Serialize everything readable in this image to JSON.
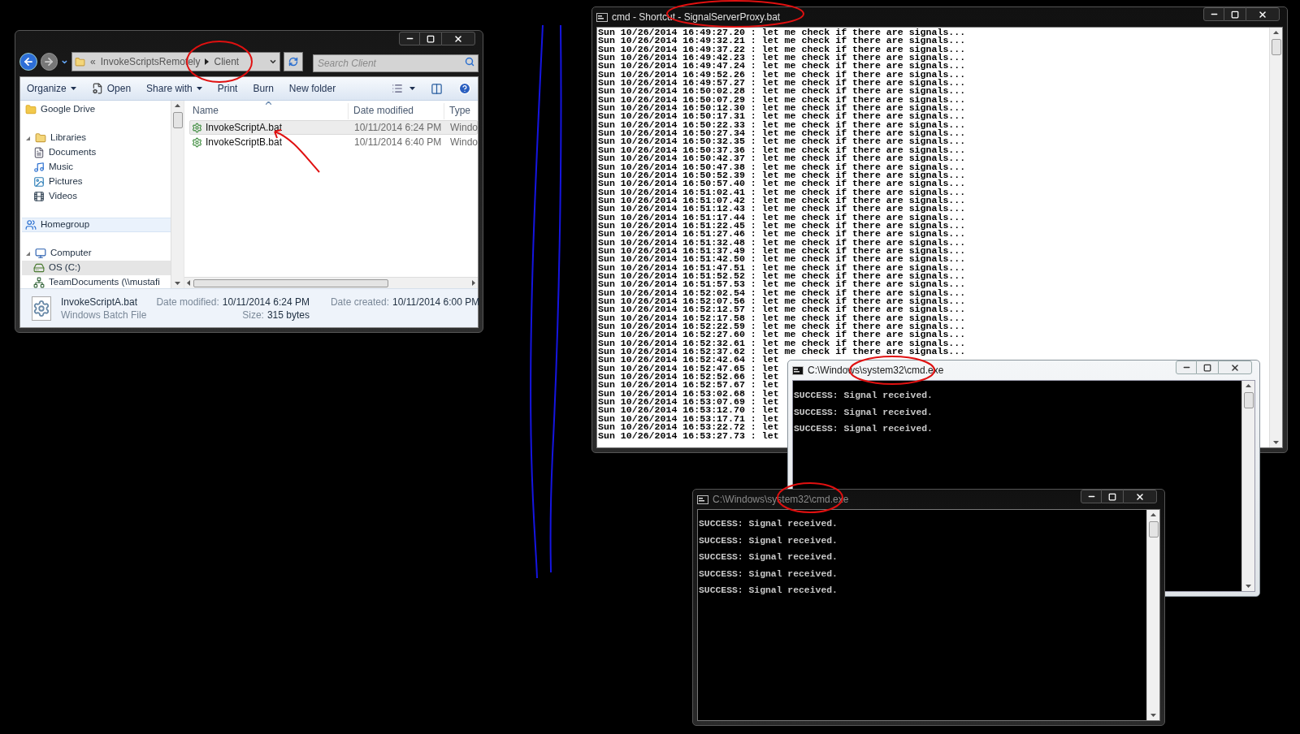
{
  "explorer": {
    "address": {
      "overflow": "«",
      "path": [
        "InvokeScriptsRemotely",
        "Client"
      ]
    },
    "search": {
      "placeholder": "Search Client"
    },
    "toolbar": [
      {
        "label": "Organize",
        "dropdown": true,
        "has_icon": false
      },
      {
        "label": "Open",
        "dropdown": false,
        "has_icon": true
      },
      {
        "label": "Share with",
        "dropdown": true,
        "has_icon": false
      },
      {
        "label": "Print",
        "dropdown": false,
        "has_icon": false
      },
      {
        "label": "Burn",
        "dropdown": false,
        "has_icon": false
      },
      {
        "label": "New folder",
        "dropdown": false,
        "has_icon": false
      }
    ],
    "nav": [
      {
        "label": "Google Drive",
        "kind": "drive",
        "selected": false,
        "hovered": false
      },
      {
        "label": "Libraries",
        "kind": "library",
        "selected": false,
        "hovered": false,
        "expanded": true,
        "children": [
          {
            "label": "Documents",
            "kind": "documents",
            "selected": false,
            "hovered": false
          },
          {
            "label": "Music",
            "kind": "music",
            "selected": false,
            "hovered": false
          },
          {
            "label": "Pictures",
            "kind": "pictures",
            "selected": false,
            "hovered": false
          },
          {
            "label": "Videos",
            "kind": "videos",
            "selected": false,
            "hovered": false
          }
        ]
      },
      {
        "label": "Homegroup",
        "kind": "homegroup",
        "selected": false,
        "hovered": true
      },
      {
        "label": "Computer",
        "kind": "computer",
        "selected": false,
        "hovered": false,
        "expanded": true,
        "children": [
          {
            "label": "OS (C:)",
            "kind": "disk",
            "selected": true,
            "hovered": false
          },
          {
            "label": "TeamDocuments (\\\\mustafi",
            "kind": "network",
            "selected": false,
            "hovered": false
          }
        ]
      }
    ],
    "columns": [
      "Name",
      "Date modified",
      "Type"
    ],
    "files": [
      {
        "name": "InvokeScriptA.bat",
        "modified": "10/11/2014 6:24 PM",
        "type": "Windo",
        "selected": true
      },
      {
        "name": "InvokeScriptB.bat",
        "modified": "10/11/2014 6:40 PM",
        "type": "Windo",
        "selected": false
      }
    ],
    "details": {
      "name": "InvokeScriptA.bat",
      "type": "Windows Batch File",
      "fields": [
        {
          "label": "Date modified:",
          "value": "10/11/2014 6:24 PM"
        },
        {
          "label": "Size:",
          "value": "315 bytes"
        },
        {
          "label": "Date created:",
          "value": "10/11/2014 6:00 PM"
        }
      ]
    }
  },
  "consoles": [
    {
      "title": "cmd - Shortcut - SignalServerProxy.bat",
      "active": false,
      "inverted": true,
      "lines": [
        "Sun 10/26/2014 16:49:27.20 : let me check if there are signals...",
        "Sun 10/26/2014 16:49:32.21 : let me check if there are signals...",
        "Sun 10/26/2014 16:49:37.22 : let me check if there are signals...",
        "Sun 10/26/2014 16:49:42.23 : let me check if there are signals...",
        "Sun 10/26/2014 16:49:47.24 : let me check if there are signals...",
        "Sun 10/26/2014 16:49:52.26 : let me check if there are signals...",
        "Sun 10/26/2014 16:49:57.27 : let me check if there are signals...",
        "Sun 10/26/2014 16:50:02.28 : let me check if there are signals...",
        "Sun 10/26/2014 16:50:07.29 : let me check if there are signals...",
        "Sun 10/26/2014 16:50:12.30 : let me check if there are signals...",
        "Sun 10/26/2014 16:50:17.31 : let me check if there are signals...",
        "Sun 10/26/2014 16:50:22.33 : let me check if there are signals...",
        "Sun 10/26/2014 16:50:27.34 : let me check if there are signals...",
        "Sun 10/26/2014 16:50:32.35 : let me check if there are signals...",
        "Sun 10/26/2014 16:50:37.36 : let me check if there are signals...",
        "Sun 10/26/2014 16:50:42.37 : let me check if there are signals...",
        "Sun 10/26/2014 16:50:47.38 : let me check if there are signals...",
        "Sun 10/26/2014 16:50:52.39 : let me check if there are signals...",
        "Sun 10/26/2014 16:50:57.40 : let me check if there are signals...",
        "Sun 10/26/2014 16:51:02.41 : let me check if there are signals...",
        "Sun 10/26/2014 16:51:07.42 : let me check if there are signals...",
        "Sun 10/26/2014 16:51:12.43 : let me check if there are signals...",
        "Sun 10/26/2014 16:51:17.44 : let me check if there are signals...",
        "Sun 10/26/2014 16:51:22.45 : let me check if there are signals...",
        "Sun 10/26/2014 16:51:27.46 : let me check if there are signals...",
        "Sun 10/26/2014 16:51:32.48 : let me check if there are signals...",
        "Sun 10/26/2014 16:51:37.49 : let me check if there are signals...",
        "Sun 10/26/2014 16:51:42.50 : let me check if there are signals...",
        "Sun 10/26/2014 16:51:47.51 : let me check if there are signals...",
        "Sun 10/26/2014 16:51:52.52 : let me check if there are signals...",
        "Sun 10/26/2014 16:51:57.53 : let me check if there are signals...",
        "Sun 10/26/2014 16:52:02.54 : let me check if there are signals...",
        "Sun 10/26/2014 16:52:07.56 : let me check if there are signals...",
        "Sun 10/26/2014 16:52:12.57 : let me check if there are signals...",
        "Sun 10/26/2014 16:52:17.58 : let me check if there are signals...",
        "Sun 10/26/2014 16:52:22.59 : let me check if there are signals...",
        "Sun 10/26/2014 16:52:27.60 : let me check if there are signals...",
        "Sun 10/26/2014 16:52:32.61 : let me check if there are signals...",
        "Sun 10/26/2014 16:52:37.62 : let me check if there are signals...",
        "Sun 10/26/2014 16:52:42.64 : let",
        "Sun 10/26/2014 16:52:47.65 : let",
        "Sun 10/26/2014 16:52:52.66 : let",
        "Sun 10/26/2014 16:52:57.67 : let",
        "Sun 10/26/2014 16:53:02.68 : let",
        "Sun 10/26/2014 16:53:07.69 : let",
        "Sun 10/26/2014 16:53:12.70 : let",
        "Sun 10/26/2014 16:53:17.71 : let",
        "Sun 10/26/2014 16:53:22.72 : let",
        "Sun 10/26/2014 16:53:27.73 : let"
      ]
    },
    {
      "title": "C:\\Windows\\system32\\cmd.exe",
      "active": true,
      "inverted": false,
      "lines": [
        "SUCCESS: Signal received.",
        "SUCCESS: Signal received.",
        "SUCCESS: Signal received."
      ]
    },
    {
      "title": "C:\\Windows\\system32\\cmd.exe",
      "active": false,
      "inverted": false,
      "lines": [
        "SUCCESS: Signal received.",
        "SUCCESS: Signal received.",
        "SUCCESS: Signal received.",
        "SUCCESS: Signal received.",
        "SUCCESS: Signal received."
      ]
    }
  ]
}
